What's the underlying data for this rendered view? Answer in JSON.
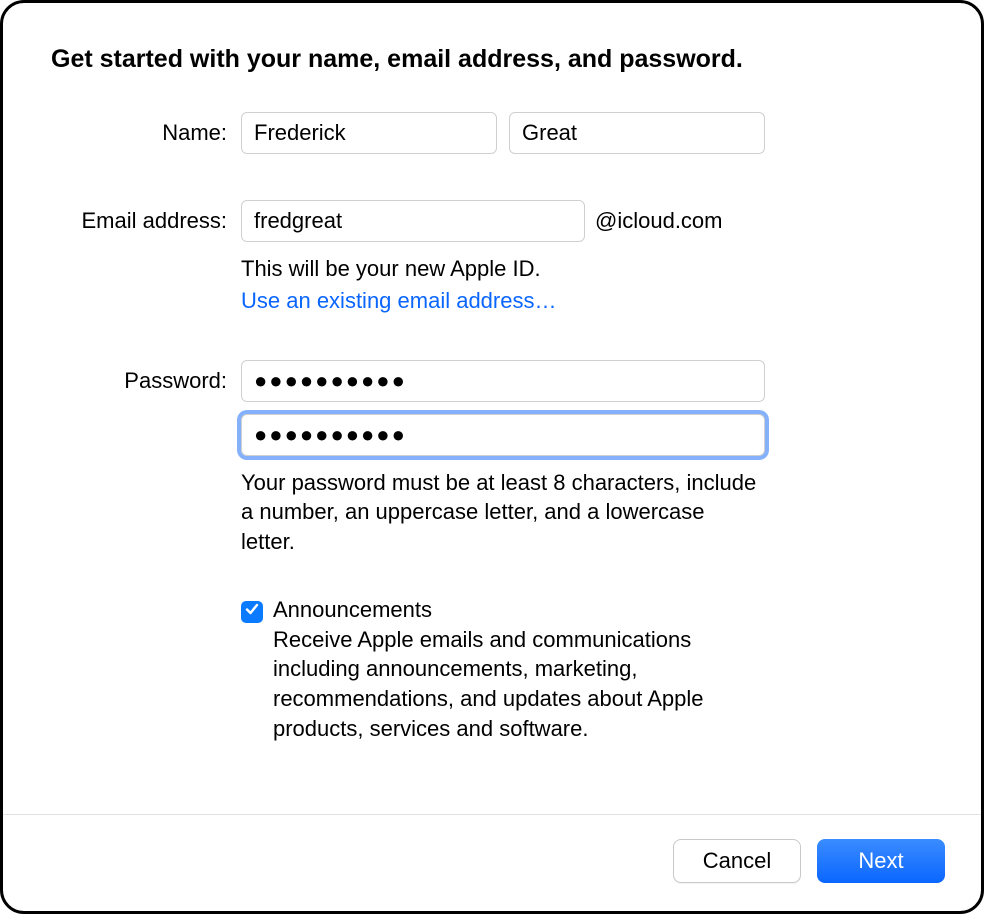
{
  "heading": "Get started with your name, email address, and password.",
  "name": {
    "label": "Name:",
    "first": "Frederick",
    "last": "Great"
  },
  "email": {
    "label": "Email address:",
    "value": "fredgreat",
    "suffix": "@icloud.com",
    "hint": "This will be your new Apple ID.",
    "link": "Use an existing email address…"
  },
  "password": {
    "label": "Password:",
    "value": "●●●●●●●●●●",
    "confirm": "●●●●●●●●●●",
    "hint": "Your password must be at least 8 characters, include a number, an uppercase letter, and a lowercase letter."
  },
  "announcements": {
    "checked": true,
    "label": "Announcements",
    "desc": "Receive Apple emails and communications including announcements, marketing, recommendations, and updates about Apple products, services and software."
  },
  "buttons": {
    "cancel": "Cancel",
    "next": "Next"
  }
}
